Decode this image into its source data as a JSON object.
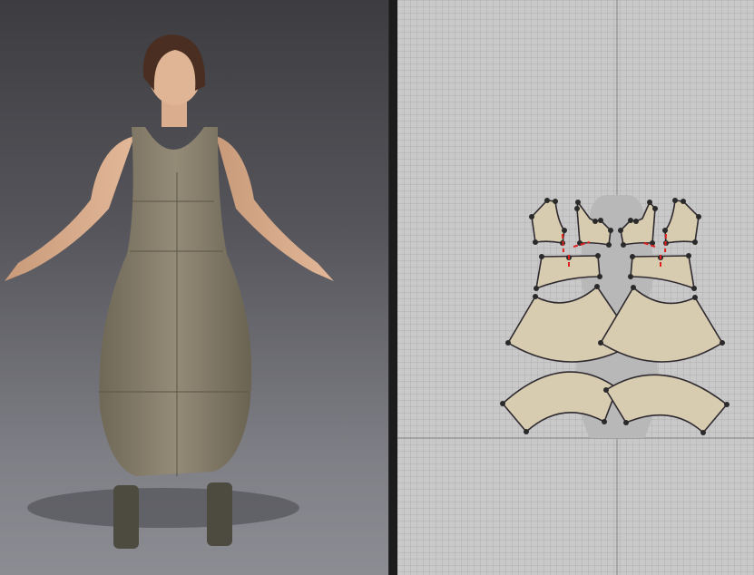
{
  "viewport_3d": {
    "background_top": "#3d3d41",
    "background_bottom": "#8c8c93",
    "garment_color": "#8a8270",
    "avatar": "female-avatar"
  },
  "viewport_2d": {
    "background": "#c9c9c9",
    "pattern_fill": "#d8ccb0",
    "pattern_outline": "#2e2a30",
    "seam_marker_color": "#e02020",
    "point_color": "#2a2a2a"
  },
  "icons": [
    "avatar-silhouette-icon"
  ]
}
